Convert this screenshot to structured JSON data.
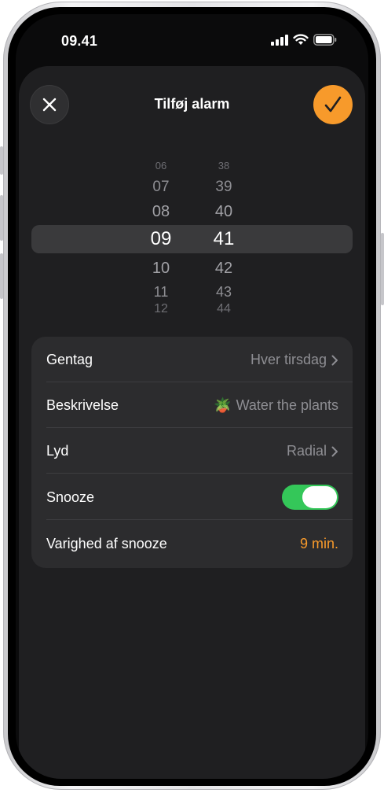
{
  "status_bar": {
    "time": "09.41",
    "icons": [
      "cellular-signal-icon",
      "wifi-icon",
      "battery-icon"
    ]
  },
  "sheet": {
    "title": "Tilføj alarm",
    "close_icon": "close-icon",
    "confirm_icon": "checkmark-icon"
  },
  "picker": {
    "hours": [
      "06",
      "07",
      "08",
      "09",
      "10",
      "11",
      "12"
    ],
    "minutes": [
      "38",
      "39",
      "40",
      "41",
      "42",
      "43",
      "44"
    ],
    "selected_hour": "09",
    "selected_minute": "41"
  },
  "settings": {
    "repeat": {
      "label": "Gentag",
      "value": "Hver tirsdag"
    },
    "description": {
      "label": "Beskrivelse",
      "emoji": "🪴",
      "value": "Water the plants"
    },
    "sound": {
      "label": "Lyd",
      "value": "Radial"
    },
    "snooze": {
      "label": "Snooze",
      "on": true
    },
    "snooze_duration": {
      "label": "Varighed af snooze",
      "value": "9 min."
    }
  },
  "colors": {
    "accent": "#f79a2b",
    "toggle_on": "#34c759",
    "sheet_bg": "#1f1f21",
    "list_bg": "#2c2c2e",
    "secondary_text": "#8e8e93"
  }
}
